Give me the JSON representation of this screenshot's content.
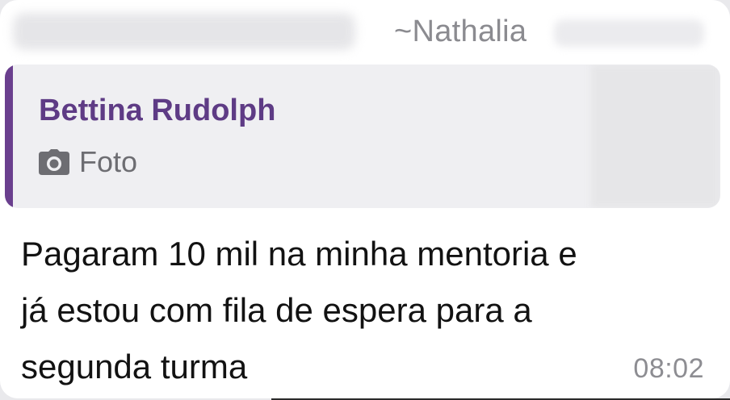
{
  "message": {
    "sender": "~Nathalia",
    "quote": {
      "author": "Bettina Rudolph",
      "media_icon": "camera-icon",
      "media_label": "Foto"
    },
    "lines": [
      "Pagaram 10 mil na minha mentoria e",
      "já estou com fila de espera para a",
      "segunda turma"
    ],
    "time": "08:02"
  },
  "colors": {
    "quote_accent": "#6a3f8e",
    "quote_author": "#5e3b85",
    "bubble_bg": "#ffffff",
    "quote_bg": "#efeff2",
    "meta_text": "#8b8b90"
  }
}
